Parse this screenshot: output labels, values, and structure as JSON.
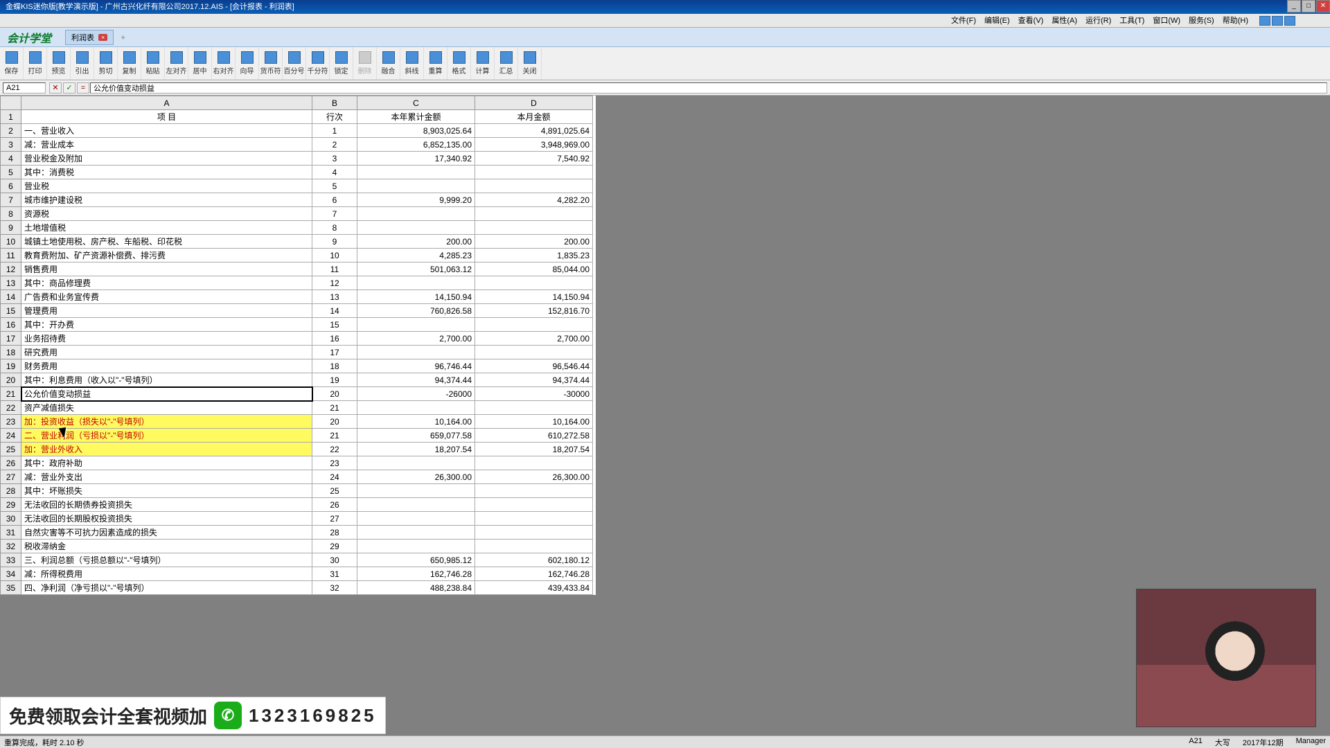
{
  "titlebar": {
    "text": "金蝶KIS迷你版[教学演示版] - 广州古兴化纤有限公司2017.12.AIS - [会计报表 - 利润表]"
  },
  "menus": [
    "文件(F)",
    "编辑(E)",
    "查看(V)",
    "属性(A)",
    "运行(R)",
    "工具(T)",
    "窗口(W)",
    "服务(S)",
    "帮助(H)"
  ],
  "brand": {
    "logo": "会计学堂",
    "tab": "利润表",
    "close": "×",
    "plus": "+"
  },
  "toolbar": [
    "保存",
    "打印",
    "预览",
    "引出",
    "剪切",
    "复制",
    "粘贴",
    "左对齐",
    "居中",
    "右对齐",
    "向导",
    "货币符",
    "百分号",
    "千分符",
    "锁定",
    "删除",
    "融合",
    "斜线",
    "重算",
    "格式",
    "计算",
    "汇总",
    "关闭"
  ],
  "formula": {
    "cell": "A21",
    "cancel": "✕",
    "ok": "✓",
    "fx": "=",
    "value": "公允价值变动损益"
  },
  "columns": {
    "A": "A",
    "B": "B",
    "C": "C",
    "D": "D"
  },
  "header_row": {
    "A": "项    目",
    "B": "行次",
    "C": "本年累计金额",
    "D": "本月金额"
  },
  "rows": [
    {
      "n": 1,
      "a": "项    目",
      "b": "行次",
      "c": "本年累计金额",
      "d": "本月金额",
      "hdr": true
    },
    {
      "n": 2,
      "a": "一、营业收入",
      "b": "1",
      "c": "8,903,025.64",
      "d": "4,891,025.64"
    },
    {
      "n": 3,
      "a": "减：营业成本",
      "b": "2",
      "c": "6,852,135.00",
      "d": "3,948,969.00"
    },
    {
      "n": 4,
      "a": "        营业税金及附加",
      "b": "3",
      "c": "17,340.92",
      "d": "7,540.92"
    },
    {
      "n": 5,
      "a": "        其中：消费税",
      "b": "4",
      "c": "",
      "d": ""
    },
    {
      "n": 6,
      "a": "                    营业税",
      "b": "5",
      "c": "",
      "d": ""
    },
    {
      "n": 7,
      "a": "                    城市维护建设税",
      "b": "6",
      "c": "9,999.20",
      "d": "4,282.20"
    },
    {
      "n": 8,
      "a": "                    资源税",
      "b": "7",
      "c": "",
      "d": ""
    },
    {
      "n": 9,
      "a": "                    土地增值税",
      "b": "8",
      "c": "",
      "d": ""
    },
    {
      "n": 10,
      "a": "                    城镇土地使用税、房产税、车船税、印花税",
      "b": "9",
      "c": "200.00",
      "d": "200.00"
    },
    {
      "n": 11,
      "a": "                    教育费附加、矿产资源补偿费、排污费",
      "b": "10",
      "c": "4,285.23",
      "d": "1,835.23"
    },
    {
      "n": 12,
      "a": "        销售费用",
      "b": "11",
      "c": "501,063.12",
      "d": "85,044.00"
    },
    {
      "n": 13,
      "a": "        其中：商品修理费",
      "b": "12",
      "c": "",
      "d": ""
    },
    {
      "n": 14,
      "a": "                    广告费和业务宣传费",
      "b": "13",
      "c": "14,150.94",
      "d": "14,150.94"
    },
    {
      "n": 15,
      "a": "        管理费用",
      "b": "14",
      "c": "760,826.58",
      "d": "152,816.70"
    },
    {
      "n": 16,
      "a": "        其中：开办费",
      "b": "15",
      "c": "",
      "d": ""
    },
    {
      "n": 17,
      "a": "                    业务招待费",
      "b": "16",
      "c": "2,700.00",
      "d": "2,700.00"
    },
    {
      "n": 18,
      "a": "                    研究费用",
      "b": "17",
      "c": "",
      "d": ""
    },
    {
      "n": 19,
      "a": "        财务费用",
      "b": "18",
      "c": "96,746.44",
      "d": "96,546.44"
    },
    {
      "n": 20,
      "a": "        其中：利息费用（收入以\"-\"号填列）",
      "b": "19",
      "c": "94,374.44",
      "d": "94,374.44"
    },
    {
      "n": 21,
      "a": "公允价值变动损益",
      "b": "20",
      "c": "-26000",
      "d": "-30000",
      "sel": true
    },
    {
      "n": 22,
      "a": "资产减值损失",
      "b": "21",
      "c": "",
      "d": ""
    },
    {
      "n": 23,
      "a": "加：投资收益（损失以\"-\"号填列）",
      "b": "20",
      "c": "10,164.00",
      "d": "10,164.00",
      "hl": true
    },
    {
      "n": 24,
      "a": "二、营业利润（亏损以\"-\"号填列）",
      "b": "21",
      "c": "659,077.58",
      "d": "610,272.58",
      "hl": true
    },
    {
      "n": 25,
      "a": "加：营业外收入",
      "b": "22",
      "c": "18,207.54",
      "d": "18,207.54",
      "hl": true
    },
    {
      "n": 26,
      "a": "        其中：政府补助",
      "b": "23",
      "c": "",
      "d": ""
    },
    {
      "n": 27,
      "a": "减：营业外支出",
      "b": "24",
      "c": "26,300.00",
      "d": "26,300.00"
    },
    {
      "n": 28,
      "a": "        其中：坏账损失",
      "b": "25",
      "c": "",
      "d": ""
    },
    {
      "n": 29,
      "a": "                    无法收回的长期债券投资损失",
      "b": "26",
      "c": "",
      "d": ""
    },
    {
      "n": 30,
      "a": "                    无法收回的长期股权投资损失",
      "b": "27",
      "c": "",
      "d": ""
    },
    {
      "n": 31,
      "a": "                    自然灾害等不可抗力因素造成的损失",
      "b": "28",
      "c": "",
      "d": ""
    },
    {
      "n": 32,
      "a": "                    税收滞纳金",
      "b": "29",
      "c": "",
      "d": ""
    },
    {
      "n": 33,
      "a": "三、利润总额（亏损总额以\"-\"号填列）",
      "b": "30",
      "c": "650,985.12",
      "d": "602,180.12"
    },
    {
      "n": 34,
      "a": "减：所得税费用",
      "b": "31",
      "c": "162,746.28",
      "d": "162,746.28"
    },
    {
      "n": 35,
      "a": "四、净利润（净亏损以\"-\"号填列）",
      "b": "32",
      "c": "488,238.84",
      "d": "439,433.84"
    }
  ],
  "banner": {
    "text1": "免费领取会计全套视频加",
    "text2": "1323169825"
  },
  "status": {
    "left": "重算完成，耗时 2.10 秒",
    "a": "A21",
    "b": "大写",
    "c": "2017年12期",
    "d": "Manager"
  }
}
